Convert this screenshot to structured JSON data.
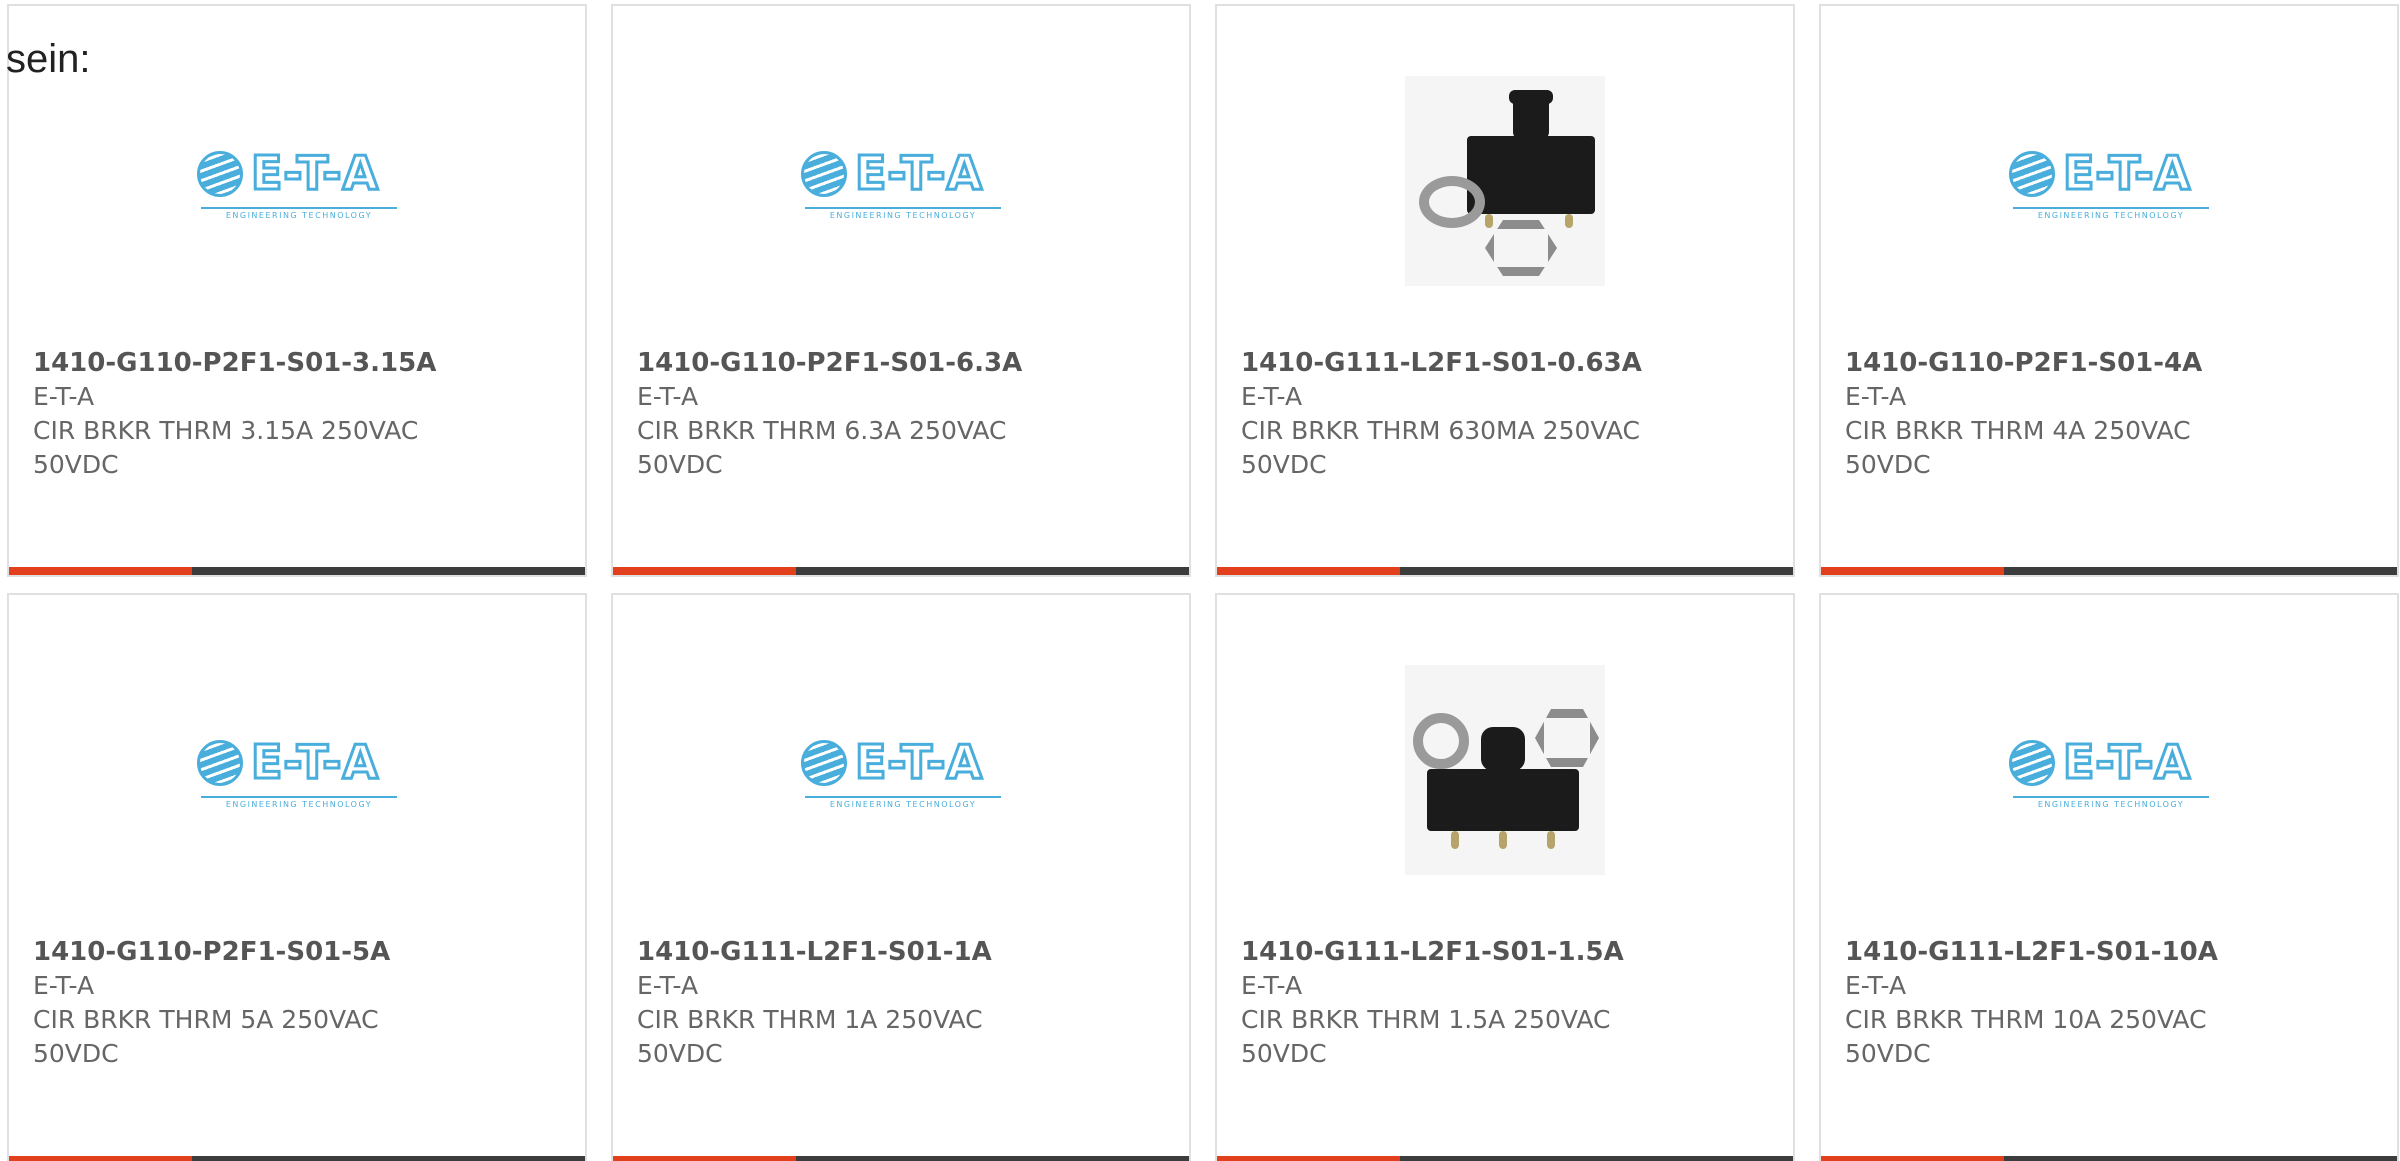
{
  "intro_text": "sein:",
  "accent_color": "#e2401c",
  "logo": {
    "brand_text": "E-T-A",
    "tagline": "ENGINEERING TECHNOLOGY"
  },
  "products": [
    {
      "part_number": "1410-G110-P2F1-S01-3.15A",
      "manufacturer": "E-T-A",
      "description": "CIR BRKR THRM 3.15A 250VAC 50VDC",
      "image": "logo"
    },
    {
      "part_number": "1410-G110-P2F1-S01-6.3A",
      "manufacturer": "E-T-A",
      "description": "CIR BRKR THRM 6.3A 250VAC 50VDC",
      "image": "logo"
    },
    {
      "part_number": "1410-G111-L2F1-S01-0.63A",
      "manufacturer": "E-T-A",
      "description": "CIR BRKR THRM 630MA 250VAC 50VDC",
      "image": "photo-a"
    },
    {
      "part_number": "1410-G110-P2F1-S01-4A",
      "manufacturer": "E-T-A",
      "description": "CIR BRKR THRM 4A 250VAC 50VDC",
      "image": "logo"
    },
    {
      "part_number": "1410-G110-P2F1-S01-5A",
      "manufacturer": "E-T-A",
      "description": "CIR BRKR THRM 5A 250VAC 50VDC",
      "image": "logo"
    },
    {
      "part_number": "1410-G111-L2F1-S01-1A",
      "manufacturer": "E-T-A",
      "description": "CIR BRKR THRM 1A 250VAC 50VDC",
      "image": "logo"
    },
    {
      "part_number": "1410-G111-L2F1-S01-1.5A",
      "manufacturer": "E-T-A",
      "description": "CIR BRKR THRM 1.5A 250VAC 50VDC",
      "image": "photo-b"
    },
    {
      "part_number": "1410-G111-L2F1-S01-10A",
      "manufacturer": "E-T-A",
      "description": "CIR BRKR THRM 10A 250VAC 50VDC",
      "image": "logo"
    }
  ]
}
